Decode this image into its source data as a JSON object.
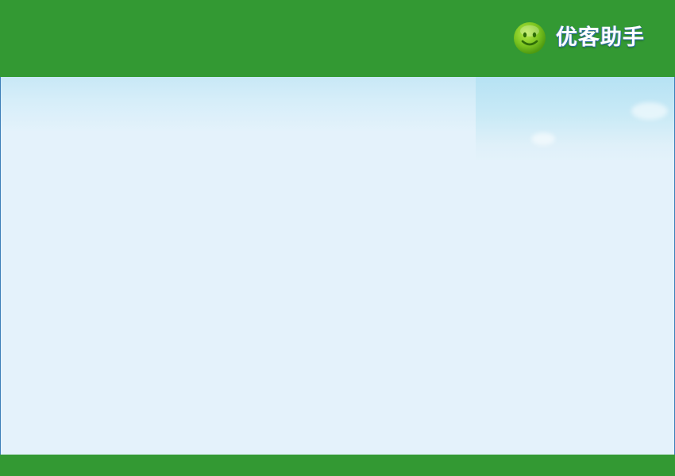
{
  "header": {
    "logo_icon": "smiley-face-icon",
    "app_name": "优客助手",
    "background_color": "#339933"
  },
  "content": {
    "background_color": "#e4f2fb"
  },
  "footer": {
    "background_color": "#339933"
  }
}
